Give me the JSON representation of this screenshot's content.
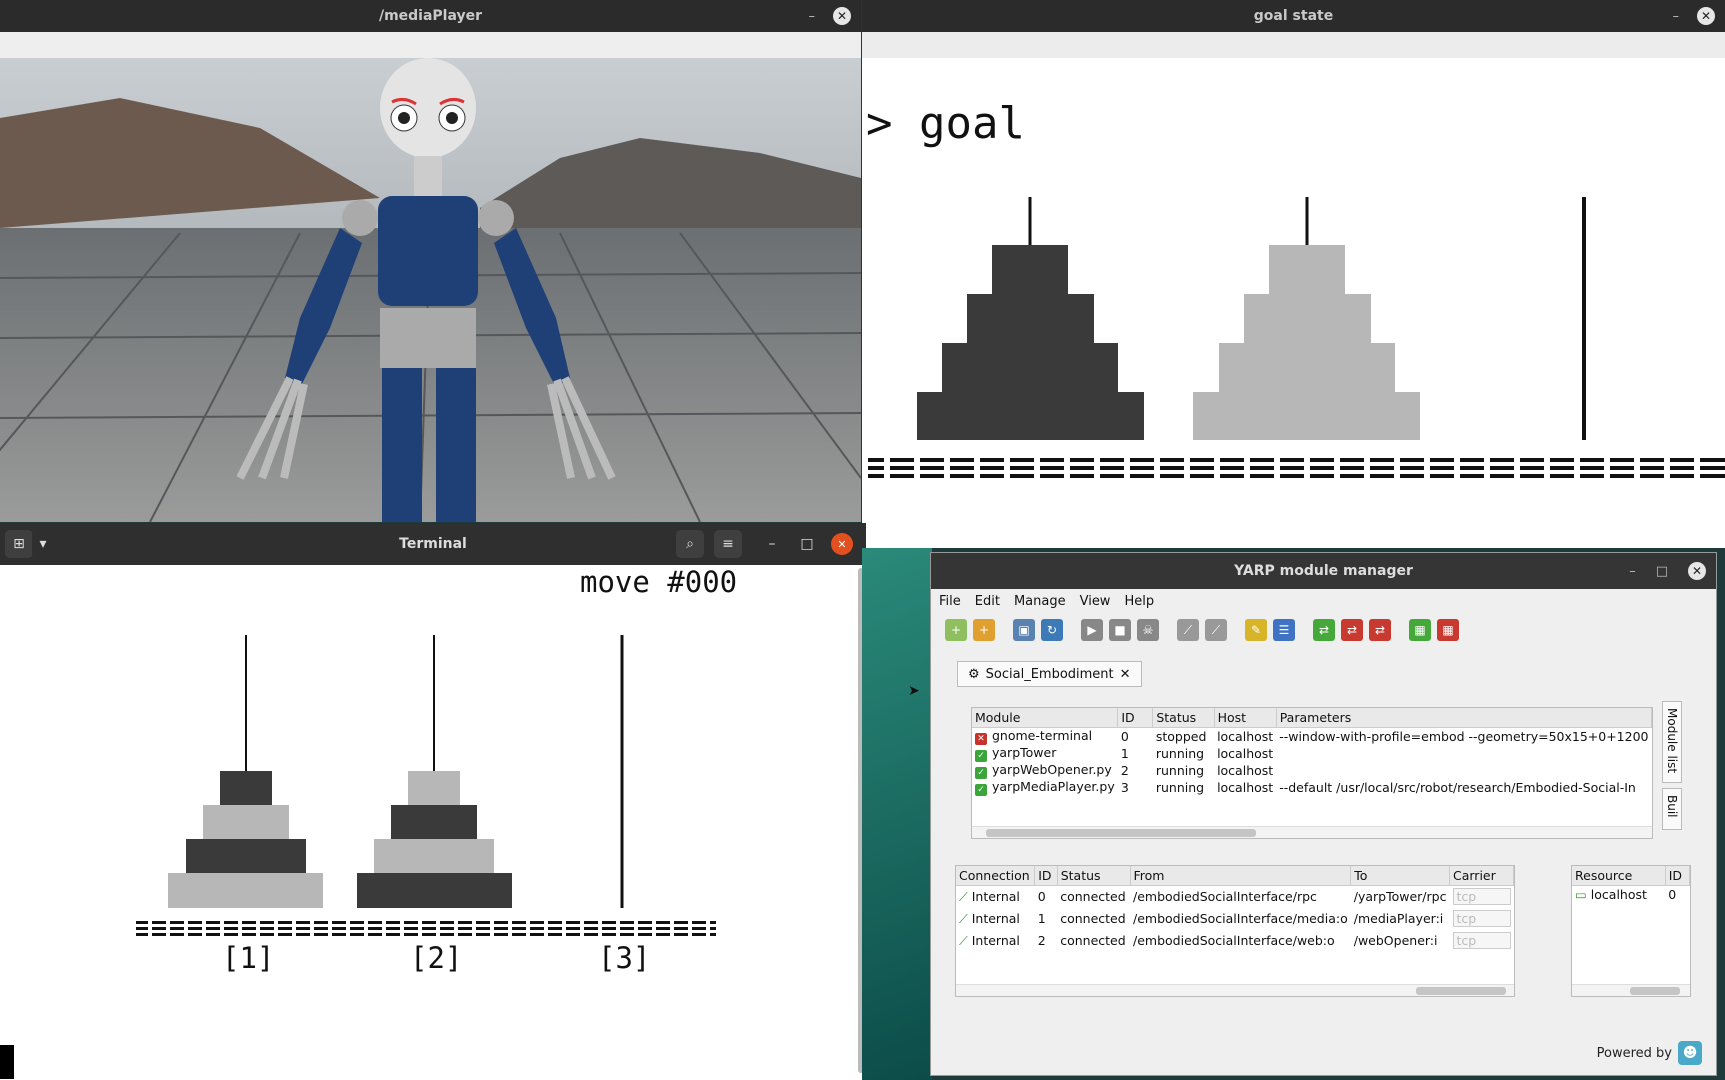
{
  "media_window": {
    "title": "/mediaPlayer"
  },
  "goal_window": {
    "title": "goal state",
    "prompt": "> goal"
  },
  "terminal": {
    "title": "Terminal",
    "move_label": "move #000",
    "pegs": [
      "[1]",
      "[2]",
      "[3]"
    ]
  },
  "yarp": {
    "title": "YARP module manager",
    "menu": [
      "File",
      "Edit",
      "Manage",
      "View",
      "Help"
    ],
    "toolbar_icons": [
      "add-icon",
      "new-icon",
      "select-icon",
      "refresh-icon",
      "run-icon",
      "stop-icon",
      "kill-icon",
      "connect-icon",
      "disconnect-icon",
      "edit-icon",
      "list-icon",
      "green-icon",
      "red-icon",
      "red2-icon",
      "table-icon",
      "table-red-icon"
    ],
    "tab_label": "Social_Embodiment",
    "module_headers": [
      "Module",
      "ID",
      "Status",
      "Host",
      "Parameters"
    ],
    "modules": [
      {
        "name": "gnome-terminal",
        "id": "0",
        "status": "stopped",
        "host": "localhost",
        "params": "--window-with-profile=embod --geometry=50x15+0+1200"
      },
      {
        "name": "yarpTower",
        "id": "1",
        "status": "running",
        "host": "localhost",
        "params": ""
      },
      {
        "name": "yarpWebOpener.py",
        "id": "2",
        "status": "running",
        "host": "localhost",
        "params": ""
      },
      {
        "name": "yarpMediaPlayer.py",
        "id": "3",
        "status": "running",
        "host": "localhost",
        "params": "--default /usr/local/src/robot/research/Embodied-Social-In"
      }
    ],
    "side_tabs": [
      "Module list",
      "Buil"
    ],
    "conn_headers": [
      "Connection",
      "ID",
      "Status",
      "From",
      "To",
      "Carrier"
    ],
    "connections": [
      {
        "type": "Internal",
        "id": "0",
        "status": "connected",
        "from": "/embodiedSocialInterface/rpc",
        "to": "/yarpTower/rpc",
        "carrier": "tcp"
      },
      {
        "type": "Internal",
        "id": "1",
        "status": "connected",
        "from": "/embodiedSocialInterface/media:o",
        "to": "/mediaPlayer:i",
        "carrier": "tcp"
      },
      {
        "type": "Internal",
        "id": "2",
        "status": "connected",
        "from": "/embodiedSocialInterface/web:o",
        "to": "/webOpener:i",
        "carrier": "tcp"
      }
    ],
    "res_headers": [
      "Resource",
      "ID"
    ],
    "resources": [
      {
        "name": "localhost",
        "id": "0"
      }
    ],
    "powered_by": "Powered by"
  }
}
